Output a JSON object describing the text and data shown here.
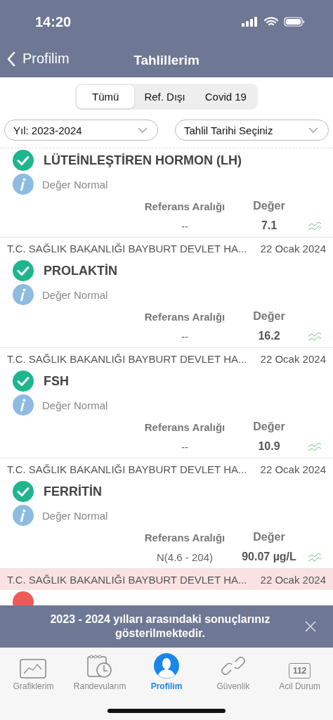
{
  "status_bar": {
    "time": "14:20"
  },
  "nav": {
    "back": "Profilim",
    "title": "Tahlillerim"
  },
  "segments": [
    {
      "label": "Tümü",
      "selected": true
    },
    {
      "label": "Ref. Dışı",
      "selected": false
    },
    {
      "label": "Covid 19",
      "selected": false
    }
  ],
  "filters": [
    {
      "value": "Yıl: 2023-2024"
    },
    {
      "value": "Tahlil Tarihi Seçiniz"
    }
  ],
  "results": [
    {
      "name": "LÜTEİNLEŞTİREN HORMON (LH)",
      "kind": "normal",
      "note": "Değer Normal",
      "ref_label": "Referans Aralığı",
      "value_label": "Değer",
      "ref": "--",
      "value": "7.1"
    },
    {
      "institution": "T.C. SAĞLIK BAKANLIĞI BAYBURT DEVLET HA...",
      "date": "22 Ocak 2024",
      "name": "PROLAKTİN",
      "kind": "normal",
      "note": "Değer Normal",
      "ref_label": "Referans Aralığı",
      "value_label": "Değer",
      "ref": "--",
      "value": "16.2"
    },
    {
      "institution": "T.C. SAĞLIK BAKANLIĞI BAYBURT DEVLET HA...",
      "date": "22 Ocak 2024",
      "name": "FSH",
      "kind": "normal",
      "note": "Değer Normal",
      "ref_label": "Referans Aralığı",
      "value_label": "Değer",
      "ref": "--",
      "value": "10.9"
    },
    {
      "institution": "T.C. SAĞLIK BAKANLIĞI BAYBURT DEVLET HA...",
      "date": "22 Ocak 2024",
      "name": "FERRİTİN",
      "kind": "normal",
      "note": "Değer Normal",
      "ref_label": "Referans Aralığı",
      "value_label": "Değer",
      "ref": "N(4.6 - 204)",
      "value": "90.07 µg/L"
    },
    {
      "institution": "T.C. SAĞLIK BAKANLIĞI BAYBURT DEVLET HA...",
      "date": "22 Ocak 2024",
      "kind": "abnormal"
    }
  ],
  "toast": {
    "message": "2023 - 2024 yılları arasındaki sonuçlarınız gösterilmektedir."
  },
  "tabs": [
    {
      "label": "Grafiklerim",
      "kind": "chart",
      "selected": false
    },
    {
      "label": "Randevularım",
      "kind": "calendar",
      "selected": false
    },
    {
      "label": "Profilim",
      "kind": "profile",
      "selected": true
    },
    {
      "label": "Güvenlik",
      "kind": "link",
      "selected": false
    },
    {
      "label": "Acil Durum",
      "kind": "emergency",
      "badge": "112",
      "selected": false
    }
  ]
}
